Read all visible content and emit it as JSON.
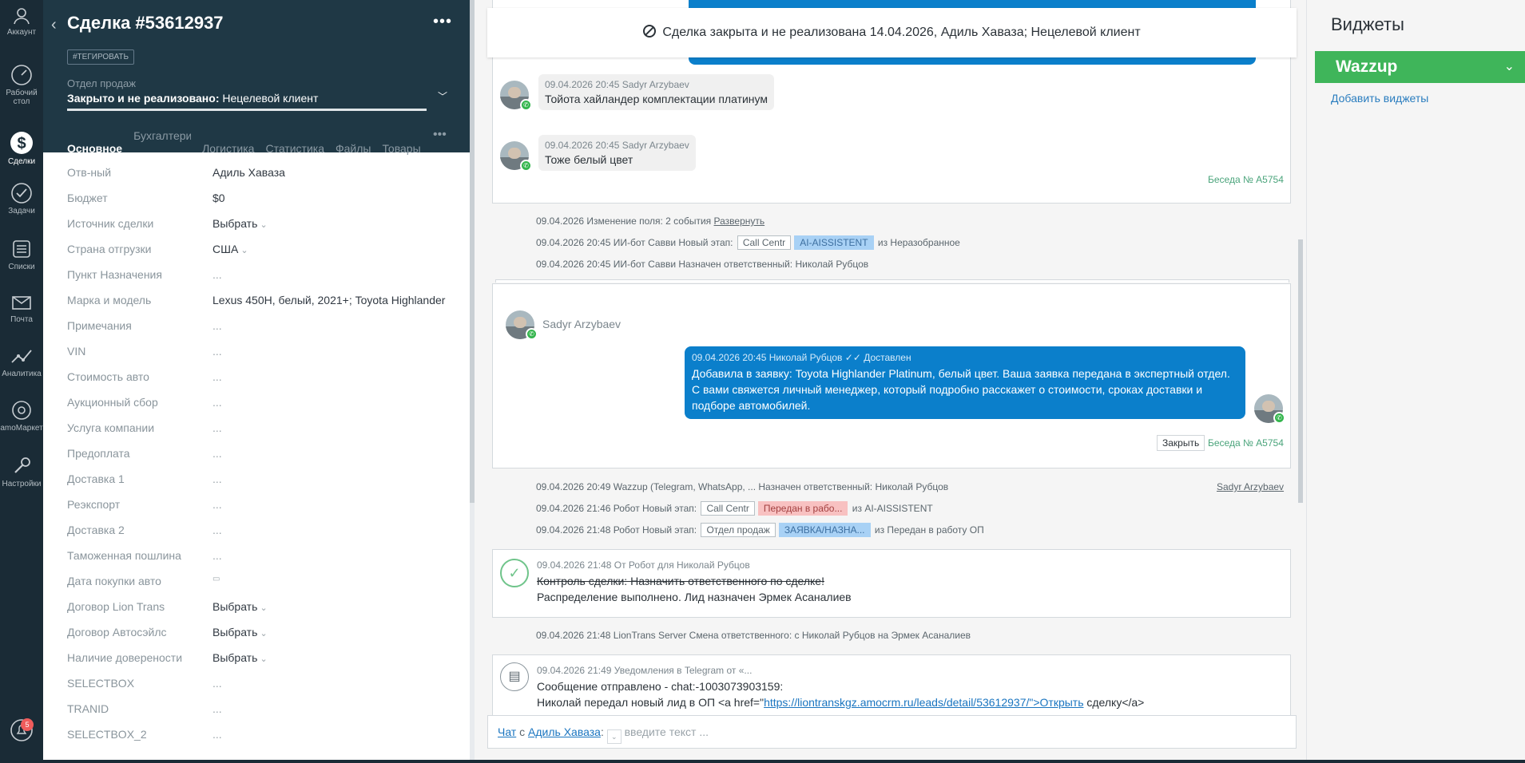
{
  "nav": {
    "items": [
      {
        "label": "Аккаунт",
        "icon": "account-icon"
      },
      {
        "label": "Рабочий стол",
        "icon": "dashboard-icon"
      },
      {
        "label": "Сделки",
        "icon": "deals-icon"
      },
      {
        "label": "Задачи",
        "icon": "tasks-icon"
      },
      {
        "label": "Списки",
        "icon": "lists-icon"
      },
      {
        "label": "Почта",
        "icon": "mail-icon"
      },
      {
        "label": "Аналитика",
        "icon": "analytics-icon"
      },
      {
        "label": "amoМаркет",
        "icon": "market-icon"
      },
      {
        "label": "Настройки",
        "icon": "settings-icon"
      }
    ],
    "notifications_badge": "5"
  },
  "deal": {
    "title": "Сделка #53612937",
    "tag_button": "#ТЕГИРОВАТЬ",
    "pipeline": "Отдел продаж",
    "status_bold": "Закрыто и не реализовано:",
    "status_reason": " Нецелевой клиент",
    "tabs": [
      "Основное",
      "Бухгалтерия",
      "Логистика",
      "Статистика",
      "Файлы",
      "Товары"
    ],
    "fields": [
      {
        "label": "Отв-ный",
        "value": "Адиль Хаваза"
      },
      {
        "label": "Бюджет",
        "value": "$0"
      },
      {
        "label": "Источник сделки",
        "value": "Выбрать"
      },
      {
        "label": "Страна отгрузки",
        "value": "США"
      },
      {
        "label": "Пункт Назначения",
        "value": "..."
      },
      {
        "label": "Марка и модель",
        "value": "Lexus 450H, белый, 2021+; Toyota Highlander"
      },
      {
        "label": "Примечания",
        "value": "..."
      },
      {
        "label": "VIN",
        "value": "..."
      },
      {
        "label": "Стоимость авто",
        "value": "..."
      },
      {
        "label": "Аукционный сбор",
        "value": "..."
      },
      {
        "label": "Услуга компании",
        "value": "..."
      },
      {
        "label": "Предоплата",
        "value": "..."
      },
      {
        "label": "Доставка 1",
        "value": "..."
      },
      {
        "label": "Реэкспорт",
        "value": "..."
      },
      {
        "label": "Доставка 2",
        "value": "..."
      },
      {
        "label": "Таможенная пошлина",
        "value": "..."
      },
      {
        "label": "Дата покупки авто",
        "value": "▭"
      },
      {
        "label": "Договор Lion Trans",
        "value": "Выбрать"
      },
      {
        "label": "Договор Автосэйлс",
        "value": "Выбрать"
      },
      {
        "label": "Наличие доверености",
        "value": "Выбрать"
      },
      {
        "label": "SELECTBOX",
        "value": "..."
      },
      {
        "label": "TRANID",
        "value": "..."
      },
      {
        "label": "SELECTBOX_2",
        "value": "..."
      }
    ]
  },
  "feed": {
    "banner": "Сделка закрыта и не реализована 14.04.2026, Адиль Хаваза; Нецелевой клиент",
    "msg1_meta": "09.04.2026 20:45 Sadyr Arzybaev",
    "msg1_text": "Тойота хайландер комплектации платинум",
    "msg2_meta": "09.04.2026 20:45 Sadyr Arzybaev",
    "msg2_text": "Тоже белый цвет",
    "conv_link": "Беседа № A5754",
    "ev1_text": "09.04.2026 Изменение поля: 2 события ",
    "ev1_link": "Развернуть",
    "ev2_text": "09.04.2026 20:45 ИИ-бот Савви Новый этап:",
    "ev2_pill1": "Call Centr",
    "ev2_pill2": "AI-AISSISTENT",
    "ev2_tail": "из Неразобранное",
    "ev3_text": "09.04.2026 20:45 ИИ-бот Савви Назначен ответственный: Николай Рубцов",
    "conv_author": "Sadyr Arzybaev",
    "out_meta": "09.04.2026 20:45 Николай Рубцов ✓✓ Доставлен",
    "out_text": "Добавила в заявку: Toyota Highlander Platinum, белый цвет. Ваша заявка передана в экспертный отдел. С вами свяжется личный менеджер, который подробно расскажет о стоимости, сроках доставки и подборе автомобилей.",
    "close_btn": "Закрыть",
    "conv_link2": "Беседа № A5754",
    "ev4_text": "09.04.2026 20:49 Wazzup (Telegram, WhatsApp, ... Назначен ответственный: Николай Рубцов",
    "ev4_right": "Sadyr Arzybaev",
    "ev5_text": "09.04.2026 21:46 Робот Новый этап:",
    "ev5_pill1": "Call Centr",
    "ev5_pill2": "Передан в рабо...",
    "ev5_tail": "из AI-AISSISTENT",
    "ev6_text": "09.04.2026 21:48 Робот Новый этап:",
    "ev6_pill1": "Отдел продаж",
    "ev6_pill2": "ЗАЯВКА/НАЗНА...",
    "ev6_tail": "из Передан в работу ОП",
    "task_meta": "09.04.2026 21:48  От Робот для Николай Рубцов",
    "task_strike": "Контроль сделки: Назначить ответственного по сделке!",
    "task_result": "Распределение выполнено. Лид назначен Эрмек Асаналиев",
    "ev7_text": "09.04.2026 21:48 LionTrans Server Смена ответственного: с Николай Рубцов на Эрмек Асаналиев",
    "note_meta": "09.04.2026 21:49 Уведомления в Telegram от «...",
    "note_line1": "Сообщение отправлено - chat:-1003073903159:",
    "note_line2_a": "Николай передал новый лид в ОП <a href=\"",
    "note_line2_link": "https://liontranskgz.amocrm.ru/leads/detail/53612937/\">Открыть",
    "note_line2_b": " сделку</a>",
    "chat_prefix_link": "Чат",
    "chat_with": " с ",
    "chat_contact": "Адиль Хаваза",
    "chat_colon": ":",
    "chat_placeholder": "введите текст ..."
  },
  "widgets": {
    "title": "Виджеты",
    "wazzup": "Wazzup",
    "add": "Добавить виджеты"
  },
  "colors": {
    "nav_bg": "#1a2b36",
    "deal_header_bg": "#1f3845",
    "outgoing_bubble": "#0b7fcb",
    "wazzup_green": "#3fb55a",
    "whatsapp_green": "#34b54d"
  }
}
